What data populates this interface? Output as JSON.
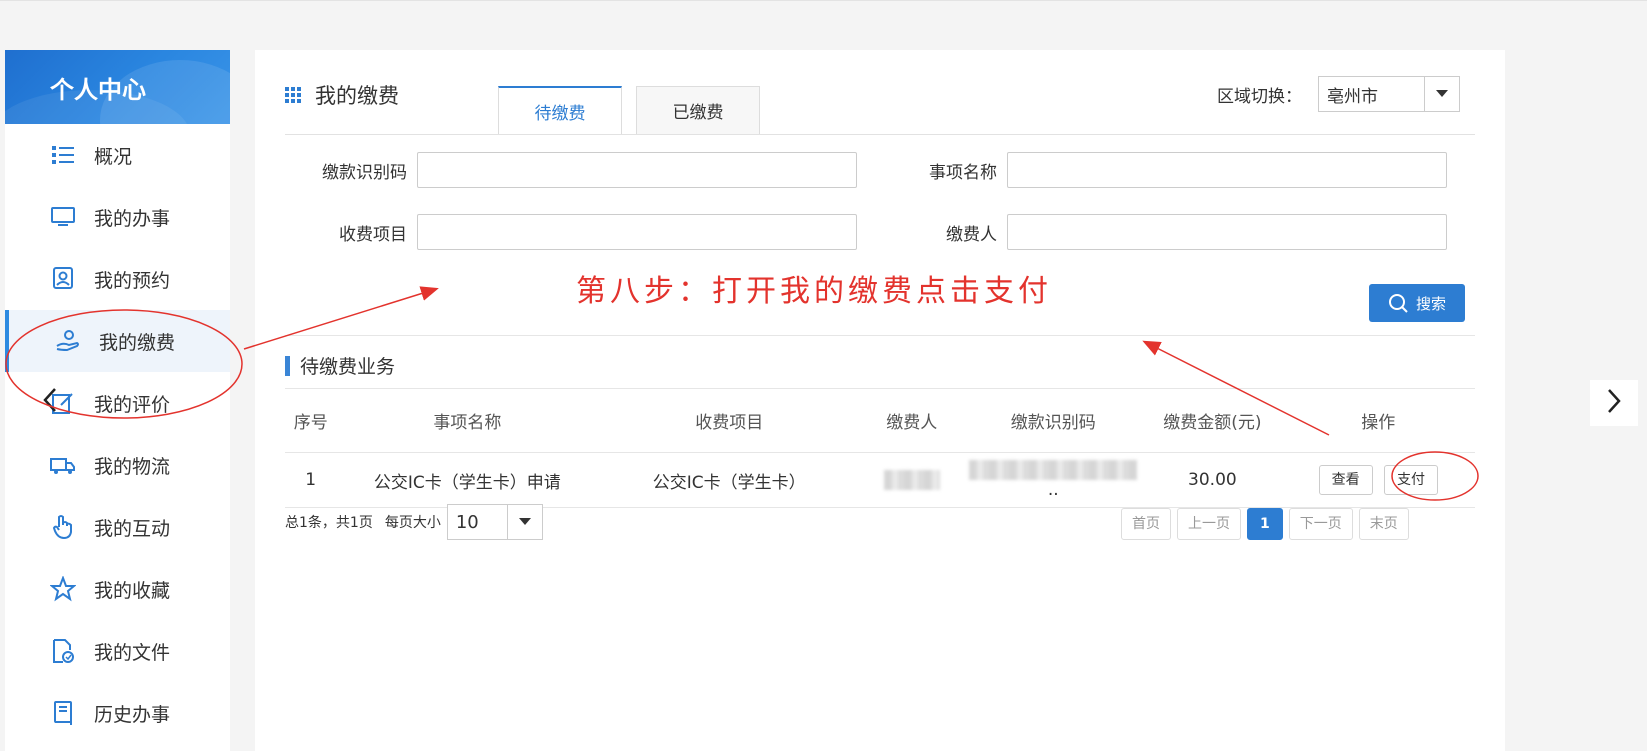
{
  "sidebar": {
    "title": "个人中心",
    "items": [
      {
        "label": "概况",
        "icon": "list-icon"
      },
      {
        "label": "我的办事",
        "icon": "monitor-icon"
      },
      {
        "label": "我的预约",
        "icon": "user-card-icon"
      },
      {
        "label": "我的缴费",
        "icon": "payment-hand-icon"
      },
      {
        "label": "我的评价",
        "icon": "edit-icon"
      },
      {
        "label": "我的物流",
        "icon": "truck-icon"
      },
      {
        "label": "我的互动",
        "icon": "pointer-hand-icon"
      },
      {
        "label": "我的收藏",
        "icon": "star-icon"
      },
      {
        "label": "我的文件",
        "icon": "file-check-icon"
      },
      {
        "label": "历史办事",
        "icon": "book-icon"
      }
    ]
  },
  "header": {
    "title": "我的缴费",
    "tabs": [
      {
        "label": "待缴费",
        "active": true
      },
      {
        "label": "已缴费",
        "active": false
      }
    ],
    "region_label": "区域切换：",
    "region_value": "亳州市"
  },
  "form": {
    "payment_code_label": "缴款识别码",
    "item_name_label": "事项名称",
    "charge_item_label": "收费项目",
    "payer_label": "缴费人",
    "search_label": "搜索"
  },
  "section_title": "待缴费业务",
  "table": {
    "headers": [
      "序号",
      "事项名称",
      "收费项目",
      "缴费人",
      "缴款识别码",
      "缴费金额(元)",
      "操作"
    ],
    "rows": [
      {
        "index": "1",
        "item_name": "公交IC卡（学生卡）申请",
        "charge_item": "公交IC卡（学生卡）",
        "code_suffix": "..",
        "amount": "30.00",
        "view_label": "查看",
        "pay_label": "支付"
      }
    ]
  },
  "pager": {
    "summary": "总1条，共1页",
    "page_size_label": "每页大小",
    "page_size": "10",
    "first": "首页",
    "prev": "上一页",
    "current": "1",
    "next": "下一页",
    "last": "末页"
  },
  "annotation": {
    "text": "第八步：打开我的缴费点击支付",
    "color": "#e3332d"
  },
  "colors": {
    "accent": "#2d7dd2",
    "sidebar_header": "#2a86e0"
  }
}
